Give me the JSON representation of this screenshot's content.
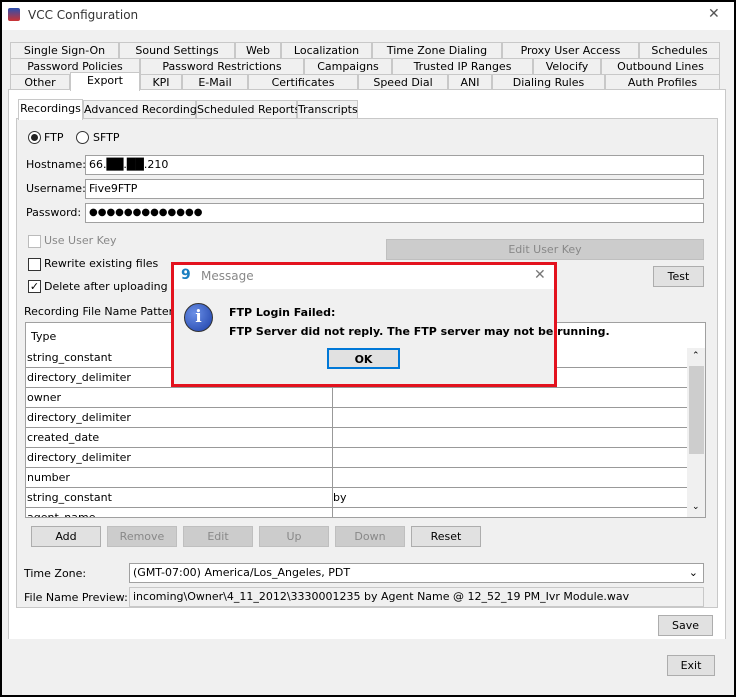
{
  "window": {
    "title": "VCC Configuration",
    "close": "✕"
  },
  "tabs": {
    "row1": [
      "Single Sign-On",
      "Sound Settings",
      "Web",
      "Localization",
      "Time Zone Dialing",
      "Proxy User Access",
      "Schedules"
    ],
    "row2": [
      "Password Policies",
      "Password Restrictions",
      "Campaigns",
      "Trusted IP Ranges",
      "Velocify",
      "Outbound Lines"
    ],
    "row3": [
      "Other",
      "Export",
      "KPI",
      "E-Mail",
      "Certificates",
      "Speed Dial",
      "ANI",
      "Dialing Rules",
      "Auth Profiles"
    ],
    "selected": "Export"
  },
  "subtabs": {
    "items": [
      "Recordings",
      "Advanced Recordings",
      "Scheduled Reports",
      "Transcripts"
    ],
    "selected": "Recordings"
  },
  "form": {
    "protocol_ftp": "FTP",
    "protocol_sftp": "SFTP",
    "protocol_selected": "FTP",
    "hostname_label": "Hostname:",
    "hostname_value": "66.██.██.210",
    "username_label": "Username:",
    "username_value": "Five9FTP",
    "password_label": "Password:",
    "password_value": "●●●●●●●●●●●●●",
    "use_user_key": "Use User Key",
    "use_user_key_checked": false,
    "edit_user_key": "Edit User Key",
    "rewrite_existing": "Rewrite existing files",
    "rewrite_checked": false,
    "delete_after": "Delete after uploading",
    "delete_checked": true,
    "test": "Test",
    "pattern_label": "Recording File Name Pattern:"
  },
  "table": {
    "header": "Type",
    "rows": [
      {
        "type": "string_constant",
        "value": ""
      },
      {
        "type": "directory_delimiter",
        "value": ""
      },
      {
        "type": "owner",
        "value": ""
      },
      {
        "type": "directory_delimiter",
        "value": ""
      },
      {
        "type": "created_date",
        "value": ""
      },
      {
        "type": "directory_delimiter",
        "value": ""
      },
      {
        "type": "number",
        "value": ""
      },
      {
        "type": "string_constant",
        "value": "by"
      },
      {
        "type": "agent_name",
        "value": ""
      }
    ]
  },
  "buttons": {
    "add": "Add",
    "remove": "Remove",
    "edit": "Edit",
    "up": "Up",
    "down": "Down",
    "reset": "Reset",
    "save": "Save",
    "exit": "Exit"
  },
  "timezone": {
    "label": "Time Zone:",
    "value": "(GMT-07:00) America/Los_Angeles, PDT"
  },
  "preview": {
    "label": "File Name Preview:",
    "value": "incoming\\Owner\\4_11_2012\\3330001235 by Agent Name @ 12_52_19 PM_Ivr Module.wav"
  },
  "dialog": {
    "title": "Message",
    "heading": "FTP Login Failed:",
    "message": "FTP Server did not reply. The FTP server may not be running.",
    "ok": "OK",
    "close": "✕",
    "highlight_color": "#e3121e"
  }
}
